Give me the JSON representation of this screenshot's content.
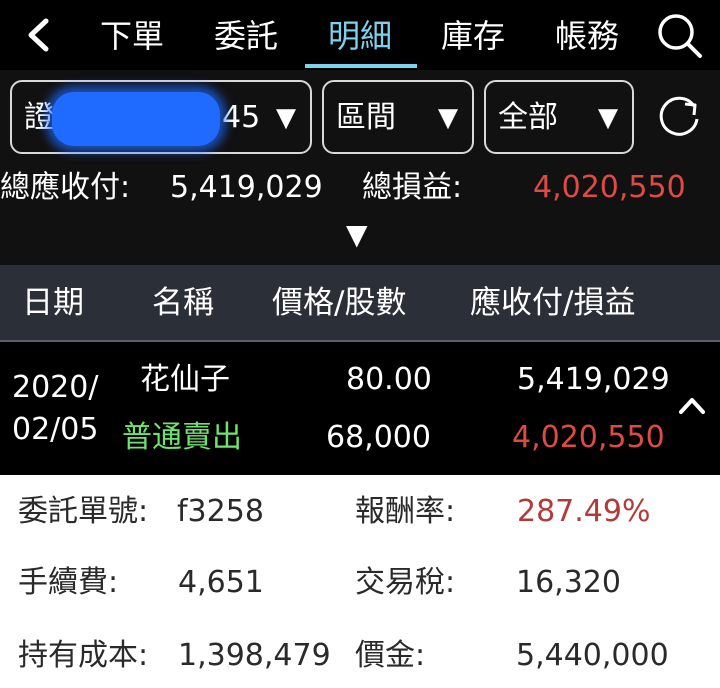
{
  "nav": {
    "back_icon": "chevron-left-icon",
    "tabs": [
      {
        "label": "下單",
        "active": false
      },
      {
        "label": "委託",
        "active": false
      },
      {
        "label": "明細",
        "active": true
      },
      {
        "label": "庫存",
        "active": false
      },
      {
        "label": "帳務",
        "active": false
      }
    ],
    "search_icon": "search-icon"
  },
  "filters": {
    "account_prefix": "證",
    "account_suffix": "45",
    "period": "區間",
    "scope": "全部",
    "dropdown_arrow": "▼",
    "refresh_icon": "refresh-icon"
  },
  "summary": {
    "receivable_label": "總應收付:",
    "receivable_value": "5,419,029",
    "pnl_label": "總損益:",
    "pnl_value": "4,020,550",
    "expand_glyph": "▼"
  },
  "table": {
    "headers": {
      "date": "日期",
      "name": "名稱",
      "price_shares": "價格/股數",
      "receivable_pnl": "應收付/損益"
    },
    "rows": [
      {
        "date_line1": "2020/",
        "date_line2": "02/05",
        "name": "花仙子",
        "order_type": "普通賣出",
        "price": "80.00",
        "shares": "68,000",
        "receivable": "5,419,029",
        "pnl": "4,020,550"
      }
    ]
  },
  "detail": {
    "order_no_label": "委託單號:",
    "order_no": "f3258",
    "return_label": "報酬率:",
    "return_value": "287.49%",
    "fee_label": "手續費:",
    "fee_value": "4,651",
    "tax_label": "交易稅:",
    "tax_value": "16,320",
    "cost_label": "持有成本:",
    "cost_value": "1,398,479",
    "amount_label": "價金:",
    "amount_value": "5,440,000"
  },
  "colors": {
    "accent": "#7fd0ea",
    "loss_gain_red": "#e04a44",
    "sell_green": "#6fe36f",
    "header_bg": "#2b2f37"
  }
}
